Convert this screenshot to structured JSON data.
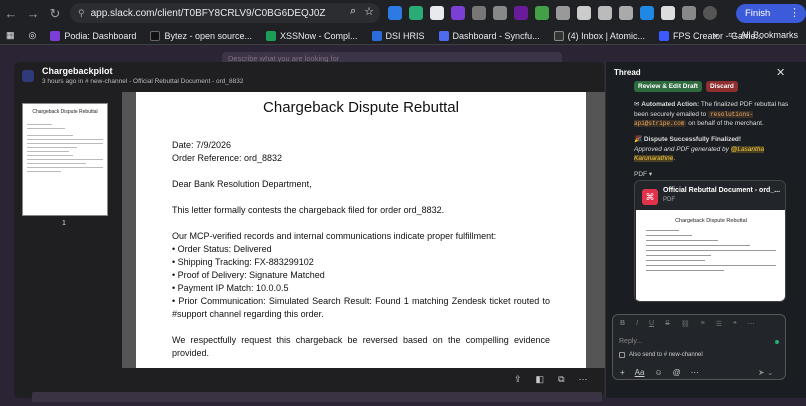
{
  "browser": {
    "url": "app.slack.com/client/T0BFY8CRLV9/C0BG6DEQJ0Z",
    "finish_update": "Finish update",
    "bookmarks": [
      {
        "label": "Podia: Dashboard",
        "color": "#7b3fd6"
      },
      {
        "label": "Bytez - open source...",
        "color": "#111111"
      },
      {
        "label": "XSSNow - Compl...",
        "color": "#1d9e58"
      },
      {
        "label": "DSI HRIS",
        "color": "#2b6cd9"
      },
      {
        "label": "Dashboard - Syncfu...",
        "color": "#4f6bed"
      },
      {
        "label": "(4) Inbox | Atomic...",
        "color": "#333333"
      },
      {
        "label": "FPS Creator - Game...",
        "color": "#3d5afe"
      }
    ],
    "all_bookmarks": "All Bookmarks"
  },
  "slack": {
    "search_placeholder": "Describe what you are looking for"
  },
  "viewer": {
    "app_name": "Chargebackpilot",
    "meta": "3 hours ago in # new-channel  - Official Rebuttal Document - ord_8832",
    "page_number": "1",
    "document": {
      "title": "Chargeback Dispute Rebuttal",
      "date": "Date: 7/9/2026",
      "order_ref": "Order Reference: ord_8832",
      "salutation": "Dear Bank Resolution Department,",
      "intro": "This letter formally contests the chargeback filed for order ord_8832.",
      "evidence_intro": "Our MCP-verified records and internal communications indicate proper fulfillment:",
      "bullets": [
        "• Order Status: Delivered",
        "• Shipping Tracking: FX-883299102",
        "• Proof of Delivery: Signature Matched",
        "• Payment IP Match: 10.0.0.5",
        "• Prior Communication: Simulated Search Result: Found 1 matching Zendesk ticket routed to #support channel regarding this order."
      ],
      "closing": "We respectfully request this chargeback be reversed based on the compelling evidence provided."
    }
  },
  "thread": {
    "title": "Thread",
    "review_button": "Review & Edit Draft",
    "discard_button": "Discard",
    "automated_label": "Automated Action:",
    "automated_text": " The finalized PDF rebuttal has been securely emailed to ",
    "email_code": "resolutions-api@stripe.com",
    "automated_tail": " on behalf of the merchant.",
    "finalized_title": "Dispute Successfully Finalized!",
    "approved_text": "Approved and PDF generated by ",
    "approver": "@Lasantha Karunarathne",
    "pdf_label": "PDF",
    "file_name": "Official Rebuttal Document - ord_...",
    "file_type": "PDF",
    "preview_title": "Chargeback Dispute Rebuttal",
    "reply_placeholder": "Reply...",
    "also_send": "Also send to # new-channel"
  }
}
